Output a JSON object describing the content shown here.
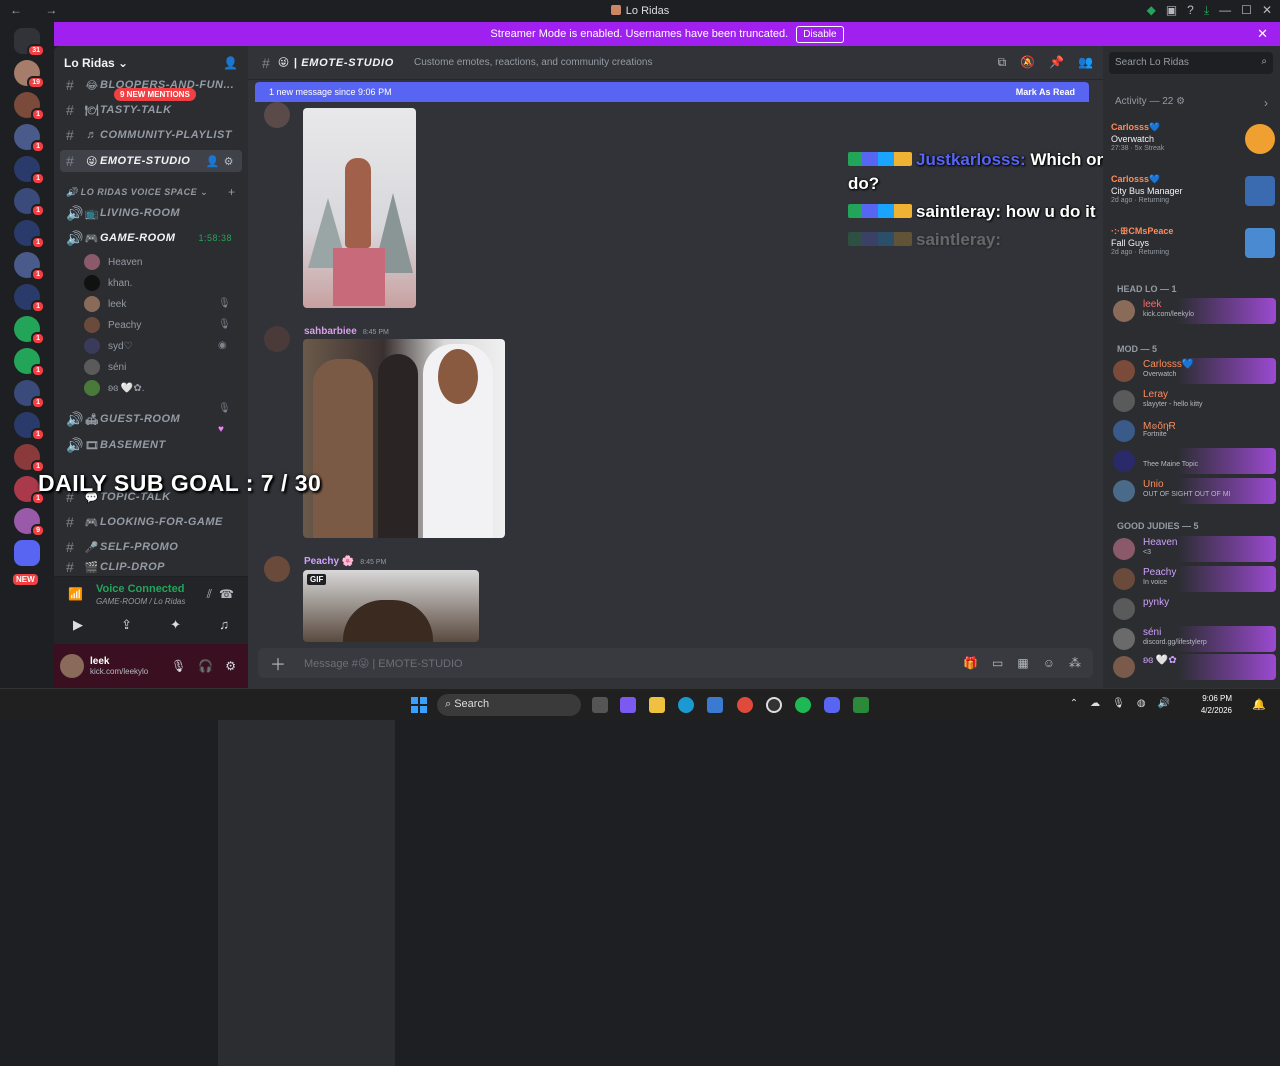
{
  "window": {
    "title": "Lo Ridas"
  },
  "banner": {
    "text": "Streamer Mode is enabled. Usernames have been truncated.",
    "button": "Disable"
  },
  "servers": [
    {
      "badge": "31"
    },
    {
      "badge": "19"
    },
    {
      "badge": "1"
    },
    {
      "badge": "1"
    },
    {
      "badge": "1"
    },
    {
      "badge": "1"
    },
    {
      "badge": "1"
    },
    {
      "badge": "1"
    },
    {
      "badge": "1"
    },
    {
      "badge": "1"
    },
    {
      "badge": "1"
    },
    {
      "badge": "1"
    },
    {
      "badge": "1"
    },
    {
      "badge": "1"
    },
    {
      "badge": "1"
    },
    {
      "badge": "2"
    },
    {
      "badge": "1"
    },
    {
      "badge": "9"
    }
  ],
  "new_label": "NEW",
  "guild": {
    "name": "Lo Ridas"
  },
  "mentions_pill": "9 NEW MENTIONS",
  "channels": {
    "bloopers": "BLOOPERS-AND-FUN...",
    "tasty": "TASTY-TALK",
    "playlist": "COMMUNITY-PLAYLIST",
    "emote": "EMOTE-STUDIO",
    "voice_cat": "LO RIDAS VOICE SPACE",
    "living": "LIVING-ROOM",
    "game": "GAME-ROOM",
    "game_time": "1:58:38",
    "guest": "GUEST-ROOM",
    "basement": "BASEMENT",
    "topic": "TOPIC-TALK",
    "lfg": "LOOKING-FOR-GAME",
    "promo": "SELF-PROMO",
    "clip": "CLIP-DROP"
  },
  "voice_users": [
    "Heaven",
    "khan.",
    "leek",
    "Peachy",
    "syd♡",
    "séni",
    "ʚɞ 🤍✿."
  ],
  "voice_panel": {
    "status": "Voice Connected",
    "sub": "GAME-ROOM / Lo Ridas"
  },
  "user_panel": {
    "name": "leek",
    "status": "kick.com/leekylo"
  },
  "channel_header": {
    "name": "EMOTE-STUDIO",
    "topic": "Custome emotes, reactions, and community creations"
  },
  "new_bar": {
    "text": "1 new message since 9:06 PM",
    "mark": "Mark As Read"
  },
  "messages": [
    {
      "author": "sahbarbiee",
      "time": "8:45 PM",
      "color": "#d8a0e8"
    },
    {
      "author": "Peachy",
      "time": "8:45 PM",
      "color": "#d0a0ff"
    }
  ],
  "gif_label": "GIF",
  "overlay": {
    "u1": "Justkarlosss:",
    "t1": "Which ones you want me to do?",
    "u2": "saintleray:",
    "t2": "how u do it",
    "u3": "saintleray:"
  },
  "subgoal": "DAILY SUB GOAL : 7 / 30",
  "composer": {
    "placeholder": "Message #😜 | EMOTE-STUDIO"
  },
  "right": {
    "search": "Search Lo Ridas",
    "activity": "Activity — 22",
    "cards": [
      {
        "user": "Carlosss💙",
        "game": "Overwatch",
        "meta": "27:38 · 5x Streak"
      },
      {
        "user": "Carlosss💙",
        "game": "City Bus Manager",
        "meta": "2d ago · Returning"
      },
      {
        "user": "·:·ꕥCMsPeace",
        "game": "Fall Guys",
        "meta": "2d ago · Returning"
      }
    ],
    "groups": {
      "head": "HEAD LO — 1",
      "mod": "MOD — 5",
      "good": "GOOD JUDIES — 5"
    },
    "members": [
      {
        "name": "leek",
        "status": "kick.com/leekylo",
        "color": "#ff6b6b"
      },
      {
        "name": "Carlosss💙",
        "status": "Overwatch",
        "color": "#ff8c5a"
      },
      {
        "name": "Leray",
        "status": "slayyter - hello kitty",
        "color": "#ff8c5a"
      },
      {
        "name": "M๏ŏηɌ",
        "status": "Fortnite",
        "color": "#ff8c5a"
      },
      {
        "name": "",
        "status": "Thee Maine Topic",
        "color": "#ff8c5a"
      },
      {
        "name": "Unio",
        "status": "OUT OF SIGHT OUT OF MI",
        "color": "#ff8c5a"
      },
      {
        "name": "Heaven",
        "status": "<3",
        "color": "#d0a0ff"
      },
      {
        "name": "Peachy",
        "status": "In voice",
        "color": "#d0a0ff"
      },
      {
        "name": "pynky",
        "status": "",
        "color": "#d0a0ff"
      },
      {
        "name": "séni",
        "status": "discord.gg/lifestylerp",
        "color": "#d0a0ff"
      },
      {
        "name": "ʚɞ 🤍✿",
        "status": "",
        "color": "#d0a0ff"
      }
    ]
  },
  "taskbar": {
    "search": "Search",
    "time": "9:06 PM",
    "date": "4/2/2026"
  }
}
